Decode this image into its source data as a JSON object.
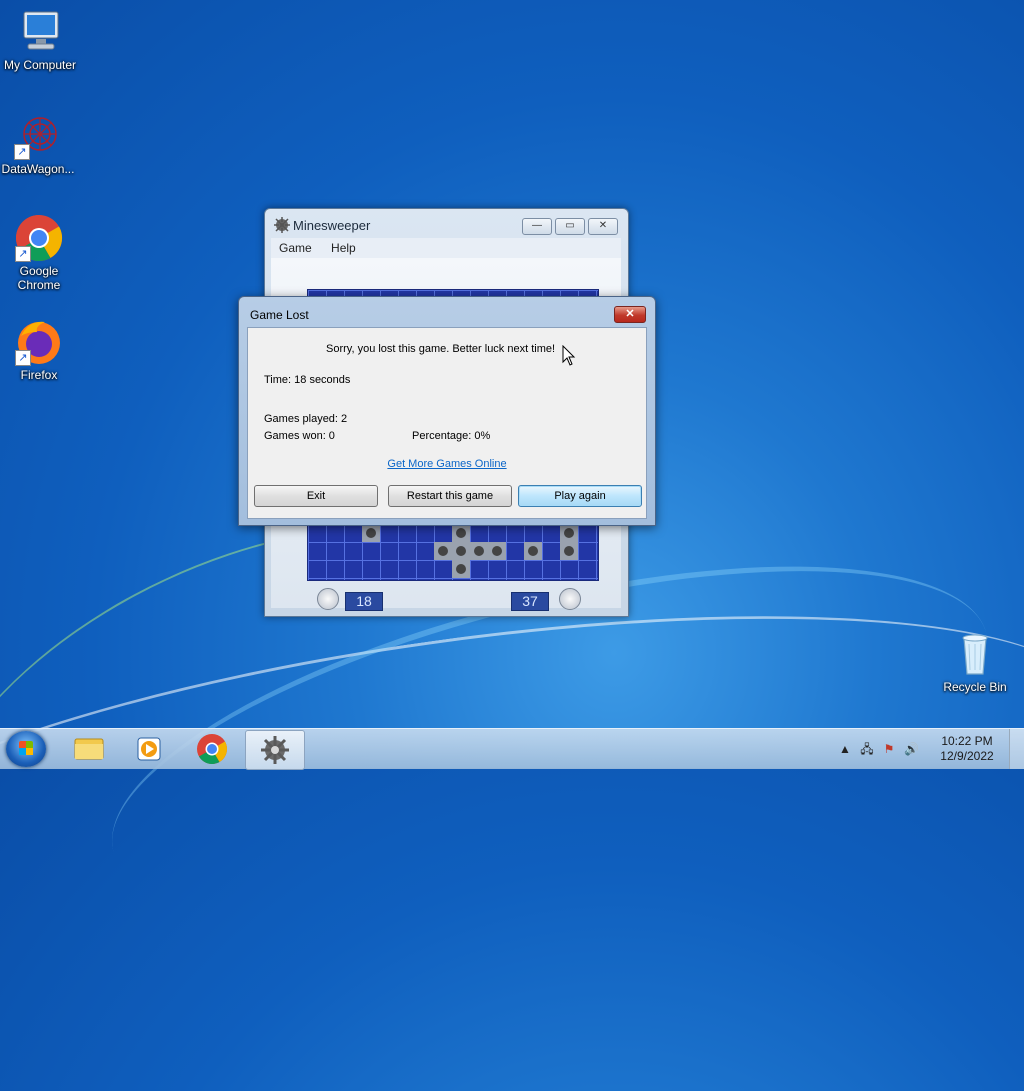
{
  "desktop": {
    "icons": [
      {
        "label": "My Computer"
      },
      {
        "label": "DataWagon..."
      },
      {
        "label": "Google Chrome"
      },
      {
        "label": "Firefox"
      },
      {
        "label": "Recycle Bin"
      }
    ]
  },
  "minesweeper": {
    "title": "Minesweeper",
    "menu": [
      "Game",
      "Help"
    ],
    "time_counter": "18",
    "mines_counter": "37",
    "caption_buttons": {
      "minimize": "—",
      "maximize": "▭",
      "close": "✕"
    }
  },
  "dialog": {
    "title": "Game Lost",
    "message": "Sorry, you lost this game. Better luck next time!",
    "time_text": "Time: 18 seconds",
    "games_played": "Games played: 2",
    "games_won": "Games won: 0",
    "percentage": "Percentage: 0%",
    "link": "Get More Games Online",
    "buttons": {
      "exit": "Exit",
      "restart": "Restart this game",
      "play_again": "Play again"
    },
    "close_glyph": "✕"
  },
  "taskbar": {
    "pinned": [
      "explorer",
      "media-player",
      "chrome",
      "minesweeper"
    ],
    "clock": {
      "time": "10:22 PM",
      "date": "12/9/2022"
    }
  },
  "colors": {
    "board": "#2236a6",
    "default_button": "#bee6fd",
    "link": "#0b66c8"
  }
}
